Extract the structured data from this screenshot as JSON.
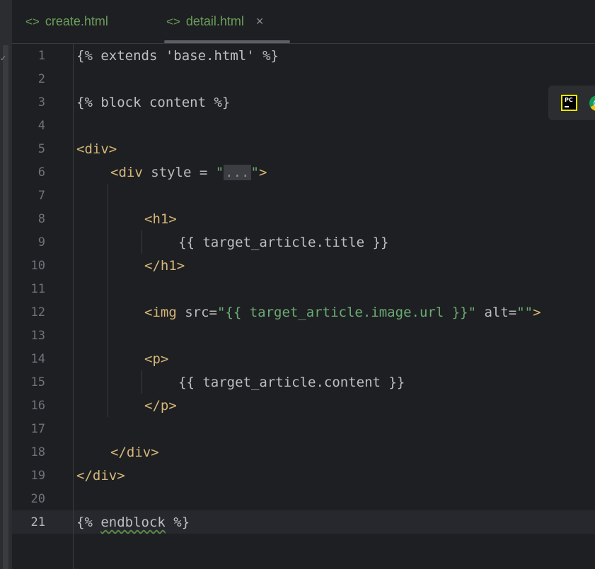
{
  "tabs": [
    {
      "icon": "<>",
      "label": "create.html"
    },
    {
      "icon": "<>",
      "label": "detail.html",
      "close": "×"
    }
  ],
  "left_strip": {
    "check_glyph": "✓"
  },
  "float_bar": {
    "pc_label": "PC"
  },
  "editor": {
    "line_numbers": [
      "1",
      "2",
      "3",
      "4",
      "5",
      "6",
      "7",
      "8",
      "9",
      "10",
      "11",
      "12",
      "13",
      "14",
      "15",
      "16",
      "17",
      "18",
      "19",
      "20",
      "21"
    ],
    "current_line": "21",
    "lines": {
      "l1": {
        "text": "{% extends 'base.html' %}"
      },
      "l3": {
        "text": "{% block content %}"
      },
      "l5": {
        "open": "<div>"
      },
      "l6": {
        "open": "<div",
        "attr": " style = ",
        "q1": "\"",
        "fold": "...",
        "q2": "\"",
        "close": ">"
      },
      "l8": {
        "tag": "<h1>"
      },
      "l9": {
        "text": "{{ target_article.title }}"
      },
      "l10": {
        "tag": "</h1>"
      },
      "l12": {
        "open": "<img",
        "attr1": " src=",
        "val1": "\"{{ target_article.image.url }}\"",
        "attr2": " alt=",
        "val2": "\"\"",
        "close": ">"
      },
      "l14": {
        "tag": "<p>"
      },
      "l15": {
        "text": "{{ target_article.content }}"
      },
      "l16": {
        "tag": "</p>"
      },
      "l18": {
        "tag": "</div>"
      },
      "l19": {
        "tag": "</div>"
      },
      "l21": {
        "pre": "{% ",
        "kw": "endblock",
        "post": " %}"
      }
    }
  }
}
